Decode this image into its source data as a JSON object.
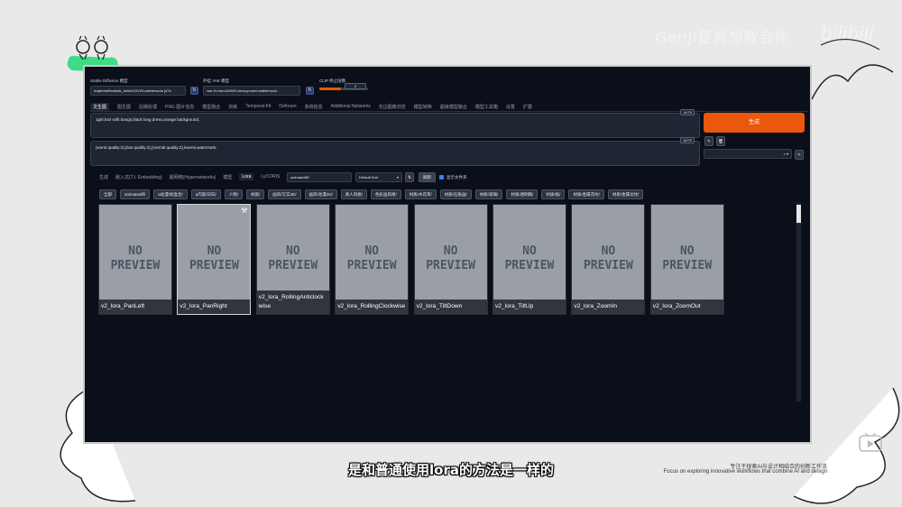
{
  "watermark": "GenJi是真想教会你",
  "footer": {
    "line1": "专注于探索AI与设计相结合的创新工作流",
    "line2": "Focus on exploring innovative workflows that combine AI and design"
  },
  "subtitle": "是和普通使用lora的方法是一样的",
  "top": {
    "model_label": "Stable Diffusion 模型",
    "model_value": "majicmixRealistic_betterV2V25.safetensors [d7e",
    "vae_label": "外挂 VAE 模型",
    "vae_value": "vae-ft-mse-840000-ema-pruned.safetensors",
    "clip_label": "CLIP 终止层数",
    "clip_value": "2",
    "clip_fraction": 0.45
  },
  "tabs": [
    "文生图",
    "图生图",
    "后期处理",
    "PNG 图片信息",
    "模型融合",
    "训练",
    "Temporal-Kit",
    "Deforum",
    "系统信息",
    "Additional Networks",
    "无边图像浏览",
    "模型转换",
    "超级模型融合",
    "模型工具箱",
    "设置",
    "扩展"
  ],
  "prompt": {
    "text": "1girl,hair with bangs,black long dress,orange background,",
    "counter": "14/75"
  },
  "negative": {
    "text": "(worst quality:2),(low quality:2),(normal quality:2),lowres,watermark,",
    "counter": "16/75"
  },
  "generate_label": "生成",
  "network_tabs": [
    "生成",
    "嵌入式(T.I. Embedding)",
    "超网络(Hypernetworks)",
    "模型",
    "Lora",
    "LyCORIS"
  ],
  "network_search": "animatediff/",
  "network_sort": "Default Sort",
  "refresh_label": "刷新",
  "show_dirs_label": "显示文件夹",
  "folder_buttons": [
    "全部",
    "animatediff/",
    "a动漫/如盒合/",
    "a内容/日向/",
    "人物/",
    "材质/",
    "画风/写实3D/",
    "画风/动漫2D/",
    "真人风格/",
    "色彩画风格/",
    "材质/木花草/",
    "材质/石板画/",
    "材质/玻璃/",
    "材质/透明稿/",
    "材质/纸/",
    "材质/金属花纹/",
    "材质/金属龙纹/"
  ],
  "cards": [
    {
      "name": "v2_lora_PanLeft",
      "preview1": "NO",
      "preview2": "PREVIEW"
    },
    {
      "name": "v2_lora_PanRight",
      "preview1": "NO",
      "preview2": "PREVIEW"
    },
    {
      "name": "v2_lora_RollingAnticlockwise",
      "preview1": "NO",
      "preview2": "PREVIEW"
    },
    {
      "name": "v2_lora_RollingClockwise",
      "preview1": "NO",
      "preview2": "PREVIEW"
    },
    {
      "name": "v2_lora_TiltDown",
      "preview1": "NO",
      "preview2": "PREVIEW"
    },
    {
      "name": "v2_lora_TiltUp",
      "preview1": "NO",
      "preview2": "PREVIEW"
    },
    {
      "name": "v2_lora_ZoomIn",
      "preview1": "NO",
      "preview2": "PREVIEW"
    },
    {
      "name": "v2_lora_ZoomOut",
      "preview1": "NO",
      "preview2": "PREVIEW"
    }
  ],
  "colors": {
    "accent": "#ea580c",
    "panel": "#0b0f19",
    "card": "#9a9fa5"
  }
}
